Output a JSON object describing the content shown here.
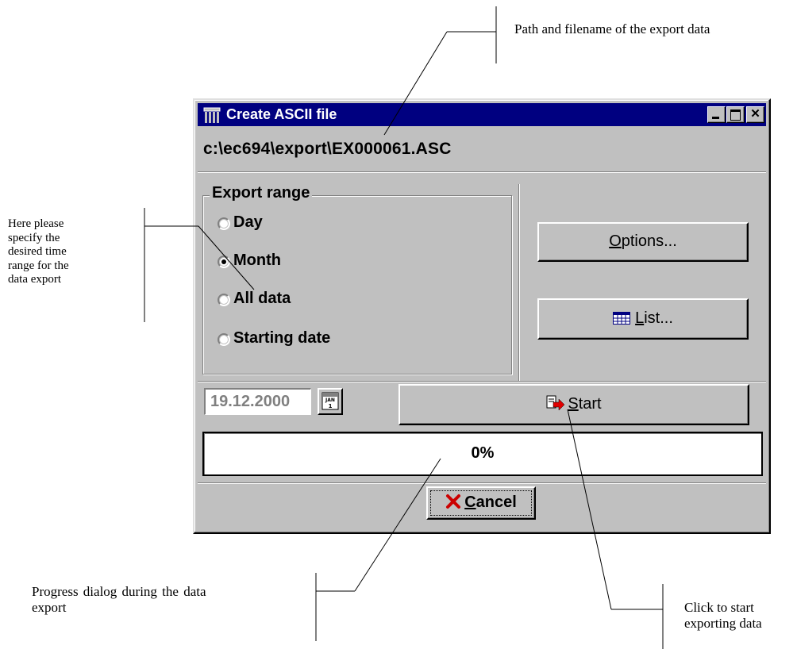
{
  "annotations": {
    "path": "Path and filename of the export data",
    "range": [
      "Here please",
      "specify the",
      "desired time",
      "range for the",
      "data export"
    ],
    "progress": [
      "Progress dialog during the data",
      "export"
    ],
    "start": [
      "Click to start",
      "exporting data"
    ]
  },
  "window": {
    "title": "Create ASCII file",
    "path": "c:\\ec694\\export\\EX000061.ASC",
    "group_label": "Export range",
    "radios": [
      {
        "label": "Day",
        "checked": false
      },
      {
        "label": "Month",
        "checked": true
      },
      {
        "label": "All data",
        "checked": false
      },
      {
        "label": "Starting date",
        "checked": false
      }
    ],
    "options_mnemonic": "O",
    "options_rest": "ptions...",
    "list_mnemonic": "L",
    "list_rest": "ist...",
    "date_value": "19.12.2000",
    "calendar_icon_text": "JAN\n1",
    "start_mnemonic": "S",
    "start_rest": "tart",
    "progress_text": "0%",
    "cancel_mnemonic": "C",
    "cancel_rest": "ancel"
  },
  "colors": {
    "titlebar": "#000080",
    "window_bg": "#c0c0c0",
    "cancel_icon": "#cc0000",
    "start_arrow": "#e00000"
  },
  "icons": [
    "app-icon",
    "minimize-icon",
    "maximize-icon",
    "close-icon",
    "calendar-icon",
    "list-table-icon",
    "start-arrow-icon",
    "cancel-x-icon"
  ]
}
